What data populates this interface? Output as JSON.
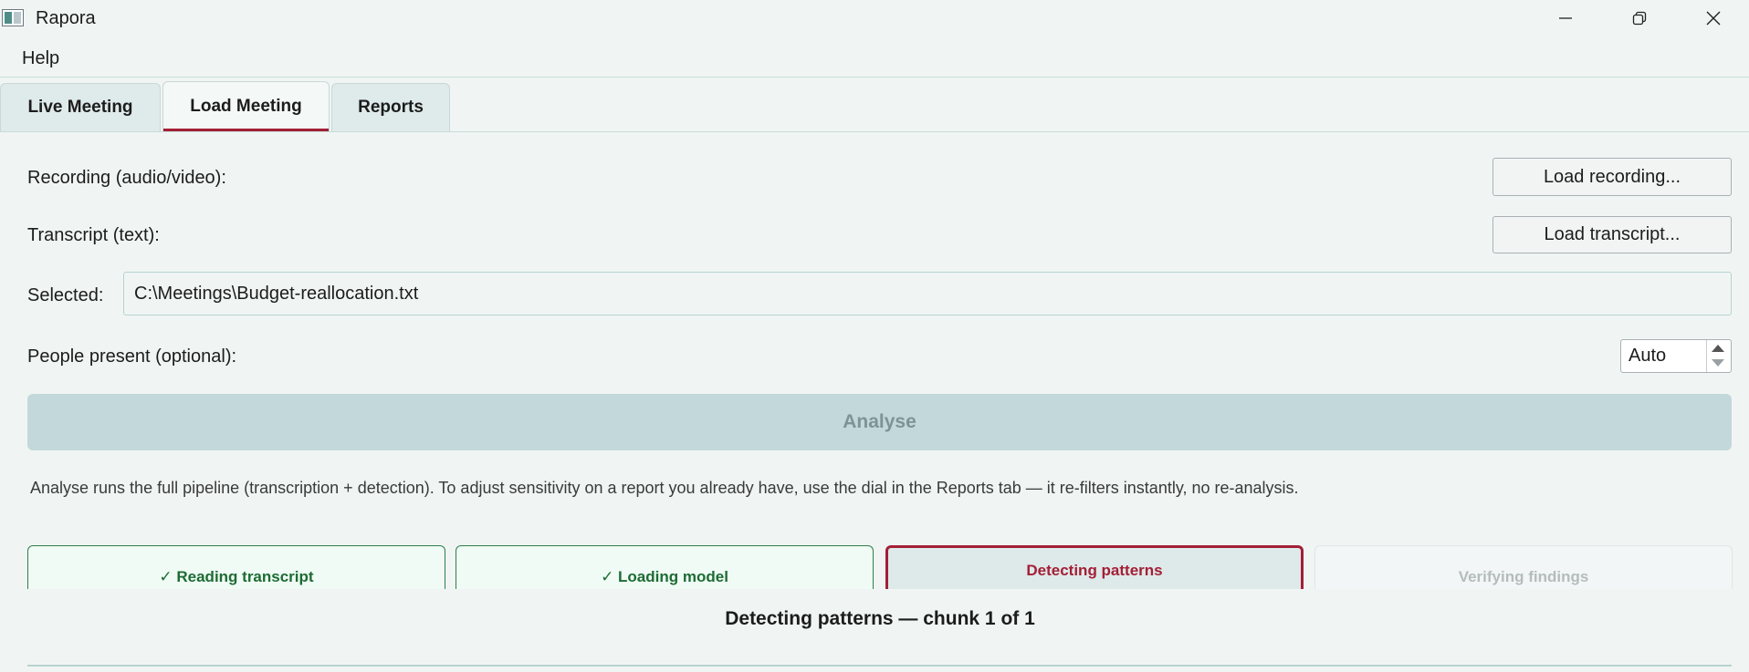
{
  "window": {
    "title": "Rapora",
    "icon": "app-window-icon"
  },
  "menu": {
    "items": [
      "Help"
    ]
  },
  "tabs": [
    {
      "label": "Live Meeting",
      "active": false
    },
    {
      "label": "Load Meeting",
      "active": true
    },
    {
      "label": "Reports",
      "active": false
    }
  ],
  "form": {
    "recording_label": "Recording (audio/video):",
    "load_recording_button": "Load recording...",
    "transcript_label": "Transcript (text):",
    "load_transcript_button": "Load transcript...",
    "selected_label": "Selected:",
    "selected_path": "C:\\Meetings\\Budget-reallocation.txt",
    "people_label": "People present (optional):",
    "people_value": "Auto",
    "analyse_button": "Analyse",
    "hint": "Analyse runs the full pipeline (transcription + detection). To adjust sensitivity on a report you already have, use the dial in the Reports tab — it re-filters instantly, no re-analysis."
  },
  "steps": [
    {
      "label": "✓ Reading transcript",
      "state": "done"
    },
    {
      "label": "✓ Loading model",
      "state": "done"
    },
    {
      "label": "Detecting patterns",
      "state": "active"
    },
    {
      "label": "Verifying findings",
      "state": "pending"
    }
  ],
  "status": "Detecting patterns — chunk 1 of 1",
  "colors": {
    "accent": "#a31f35",
    "done": "#1e6b34",
    "background": "#f0f5f4",
    "analyse_disabled": "#c3d8da"
  }
}
